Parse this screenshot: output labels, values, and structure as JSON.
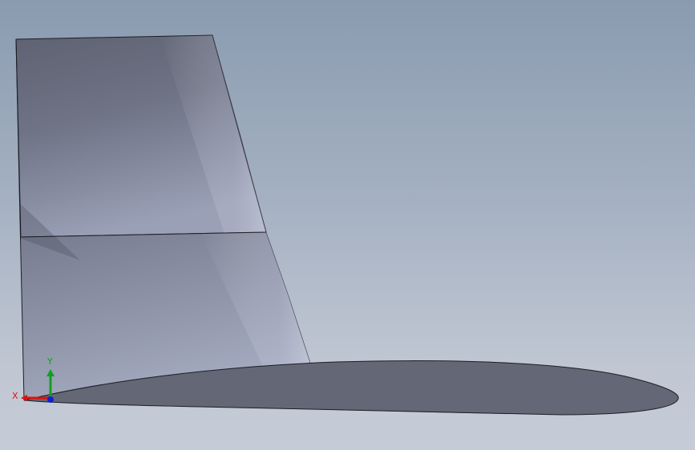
{
  "viewport": {
    "background_top": "#8a9bb0",
    "background_bottom": "#c6ccd7"
  },
  "model": {
    "fin_colors": [
      "#5e6272",
      "#747a8c",
      "#9aa0b6"
    ],
    "airfoil_color": "#636776",
    "edge_color": "#1c1e24"
  },
  "triad": {
    "x_label": "X",
    "y_label": "Y",
    "x_color": "#e01010",
    "y_color": "#10a020",
    "z_color": "#1020d0"
  }
}
